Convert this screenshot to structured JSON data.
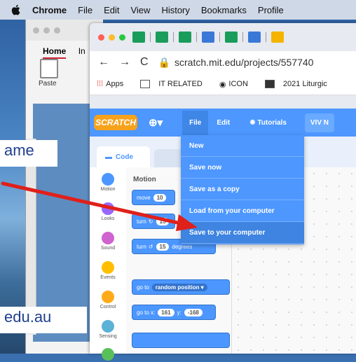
{
  "menubar": {
    "app": "Chrome",
    "items": [
      "File",
      "Edit",
      "View",
      "History",
      "Bookmarks",
      "Profile"
    ]
  },
  "word": {
    "tab_home": "Home",
    "tab_insert": "In",
    "paste": "Paste"
  },
  "slide": {
    "text_top": "ame",
    "text_bottom": "edu.au"
  },
  "chrome": {
    "url": "scratch.mit.edu/projects/557740",
    "bookmarks": [
      "Apps",
      "IT RELATED",
      "ICON",
      "2021 Liturgic"
    ]
  },
  "scratch": {
    "logo": "SCRATCH",
    "file": "File",
    "edit": "Edit",
    "tutorials": "Tutorials",
    "project_name": "VIV N",
    "code_tab": "Code",
    "palette_title": "Motion",
    "categories": [
      "Motion",
      "Looks",
      "Sound",
      "Events",
      "Control",
      "Sensing"
    ],
    "blocks": {
      "move": "move",
      "move_val": "10",
      "turn_right": "turn",
      "turn_right_val": "15",
      "turn_left": "turn",
      "turn_left_val": "15",
      "degrees": "degrees",
      "goto": "go to",
      "goto_target": "random position ▾",
      "gotoxy": "go to x:",
      "x_val": "161",
      "y_label": "y:",
      "y_val": "-168"
    }
  },
  "file_menu": {
    "items": [
      "New",
      "Save now",
      "Save as a copy",
      "Load from your computer",
      "Save to your computer"
    ]
  },
  "colors": {
    "scratch_blue": "#4d97ff",
    "arrow": "#e0201a"
  }
}
